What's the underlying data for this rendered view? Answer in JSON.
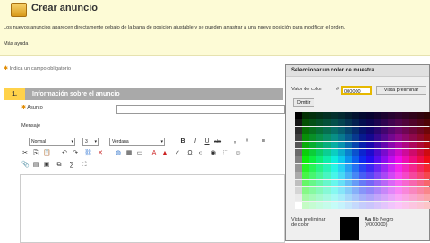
{
  "page": {
    "title": "Crear anuncio",
    "description": "Los nuevos anuncios aparecen directamente debajo de la barra de posición ajustable y se pueden arrastrar a una nueva posición para modificar el orden.",
    "help_link": "Más ayuda",
    "required_note": "Indica un campo obligatorio"
  },
  "section": {
    "number": "1.",
    "title": "Información sobre el anuncio",
    "subject_label": "Asunto",
    "message_label": "Mensaje"
  },
  "toolbar": {
    "format_value": "Normal",
    "size_value": "3",
    "font_value": "Verdana",
    "bold": "B",
    "italic": "I",
    "underline": "U",
    "strikethrough": "abc"
  },
  "color_picker": {
    "title": "Seleccionar un color de muestra",
    "value_label": "Valor de color",
    "hash": "#",
    "value": "000000",
    "preview_button": "Vista preliminar",
    "omit_button": "Omitir",
    "preview_label_1": "Vista preliminar",
    "preview_label_2": "de color",
    "sample_text_aa": "Aa",
    "sample_text_bb": "Bb",
    "sample_color_name": "Negro",
    "sample_hex": "(#000000)",
    "preview_color": "#000000",
    "accent_color": "#e6b800"
  }
}
